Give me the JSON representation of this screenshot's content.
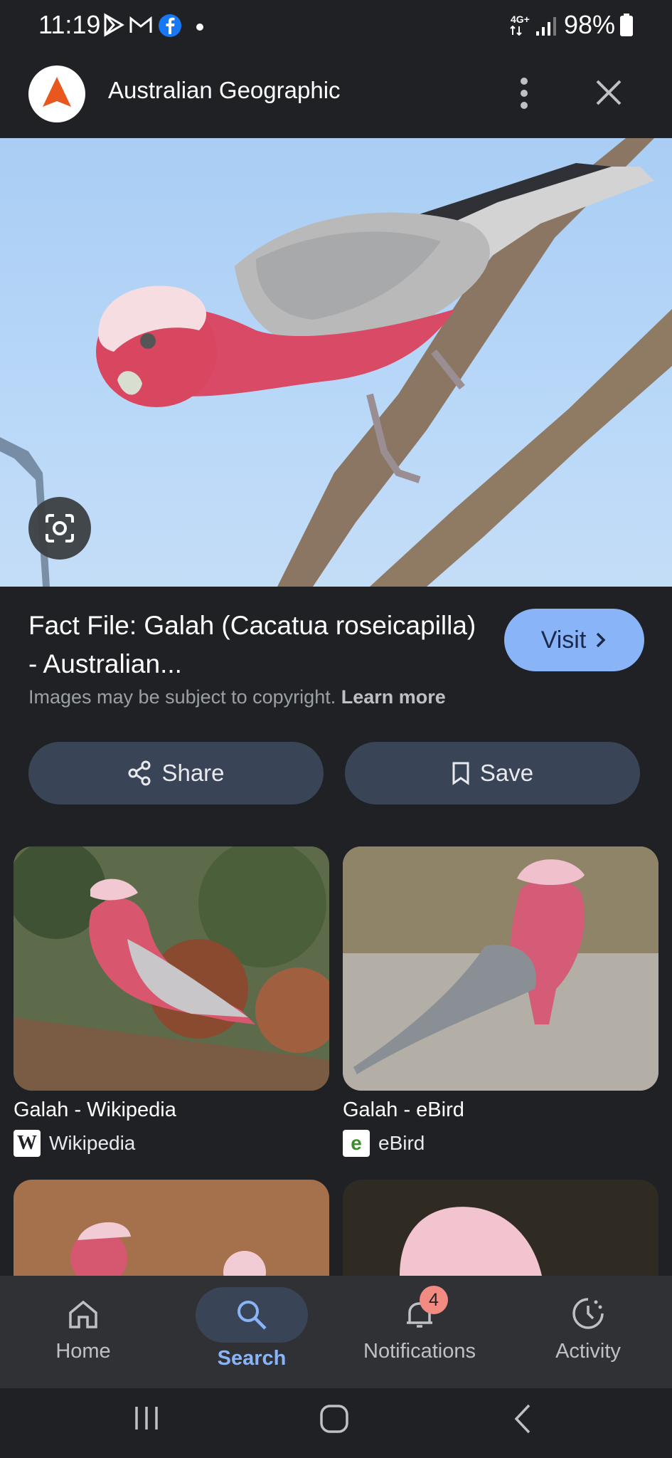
{
  "status": {
    "time": "11:19",
    "network": "4G+",
    "battery": "98%"
  },
  "header": {
    "title": "Australian Geographic",
    "logo_color": "#e8571e"
  },
  "result": {
    "title": "Fact File: Galah (Cacatua roseicapilla) - Australian...",
    "visit_label": "Visit",
    "copyright_text": "Images may be subject to copyright.",
    "learn_more": "Learn more",
    "share_label": "Share",
    "save_label": "Save"
  },
  "related": [
    {
      "title": "Galah - Wikipedia",
      "source": "Wikipedia",
      "favicon": "W"
    },
    {
      "title": "Galah - eBird",
      "source": "eBird",
      "favicon": "e"
    }
  ],
  "nav": {
    "home": "Home",
    "search": "Search",
    "notifications": "Notifications",
    "notifications_badge": "4",
    "activity": "Activity",
    "accent": "#8ab4f8"
  }
}
